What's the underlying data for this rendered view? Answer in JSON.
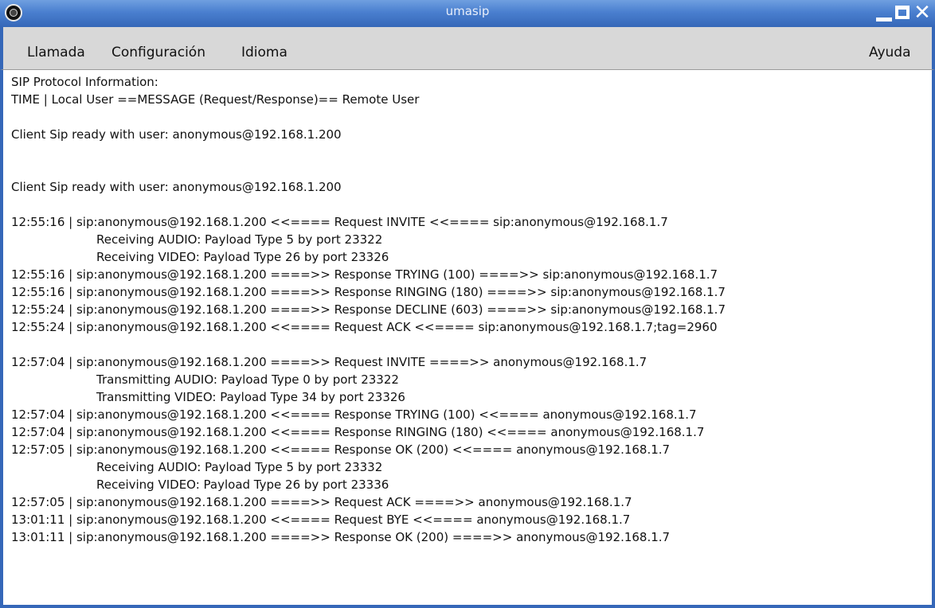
{
  "window": {
    "title": "umasip"
  },
  "menu": {
    "llamada": "Llamada",
    "configuracion": "Configuración",
    "idioma": "Idioma",
    "ayuda": "Ayuda"
  },
  "log": {
    "lines": [
      "SIP Protocol Information:",
      "TIME | Local User ==MESSAGE (Request/Response)== Remote User",
      "",
      "Client Sip ready with user: anonymous@192.168.1.200",
      "",
      "",
      "Client Sip ready with user: anonymous@192.168.1.200",
      "",
      "12:55:16 | sip:anonymous@192.168.1.200 <<==== Request INVITE <<==== sip:anonymous@192.168.1.7",
      "Receiving AUDIO: Payload Type 5 by port 23322",
      "Receiving VIDEO: Payload Type 26 by port 23326",
      "12:55:16 | sip:anonymous@192.168.1.200 ====>> Response TRYING (100) ====>> sip:anonymous@192.168.1.7",
      "12:55:16 | sip:anonymous@192.168.1.200 ====>> Response RINGING (180) ====>> sip:anonymous@192.168.1.7",
      "12:55:24 | sip:anonymous@192.168.1.200 ====>> Response DECLINE (603) ====>> sip:anonymous@192.168.1.7",
      "12:55:24 | sip:anonymous@192.168.1.200 <<==== Request ACK <<==== sip:anonymous@192.168.1.7;tag=2960",
      "",
      "12:57:04 | sip:anonymous@192.168.1.200 ====>> Request INVITE ====>> anonymous@192.168.1.7",
      "Transmitting AUDIO: Payload Type 0 by port 23322",
      "Transmitting VIDEO: Payload Type 34 by port 23326",
      "12:57:04 | sip:anonymous@192.168.1.200 <<==== Response TRYING (100) <<==== anonymous@192.168.1.7",
      "12:57:04 | sip:anonymous@192.168.1.200 <<==== Response RINGING (180) <<==== anonymous@192.168.1.7",
      "12:57:05 | sip:anonymous@192.168.1.200 <<==== Response OK (200) <<==== anonymous@192.168.1.7",
      "Receiving AUDIO: Payload Type 5 by port 23332",
      "Receiving VIDEO: Payload Type 26 by port 23336",
      "12:57:05 | sip:anonymous@192.168.1.200 ====>> Request ACK ====>> anonymous@192.168.1.7",
      "13:01:11 | sip:anonymous@192.168.1.200 <<==== Request BYE <<==== anonymous@192.168.1.7",
      "13:01:11 | sip:anonymous@192.168.1.200 ====>> Response OK (200) ====>> anonymous@192.168.1.7"
    ]
  }
}
